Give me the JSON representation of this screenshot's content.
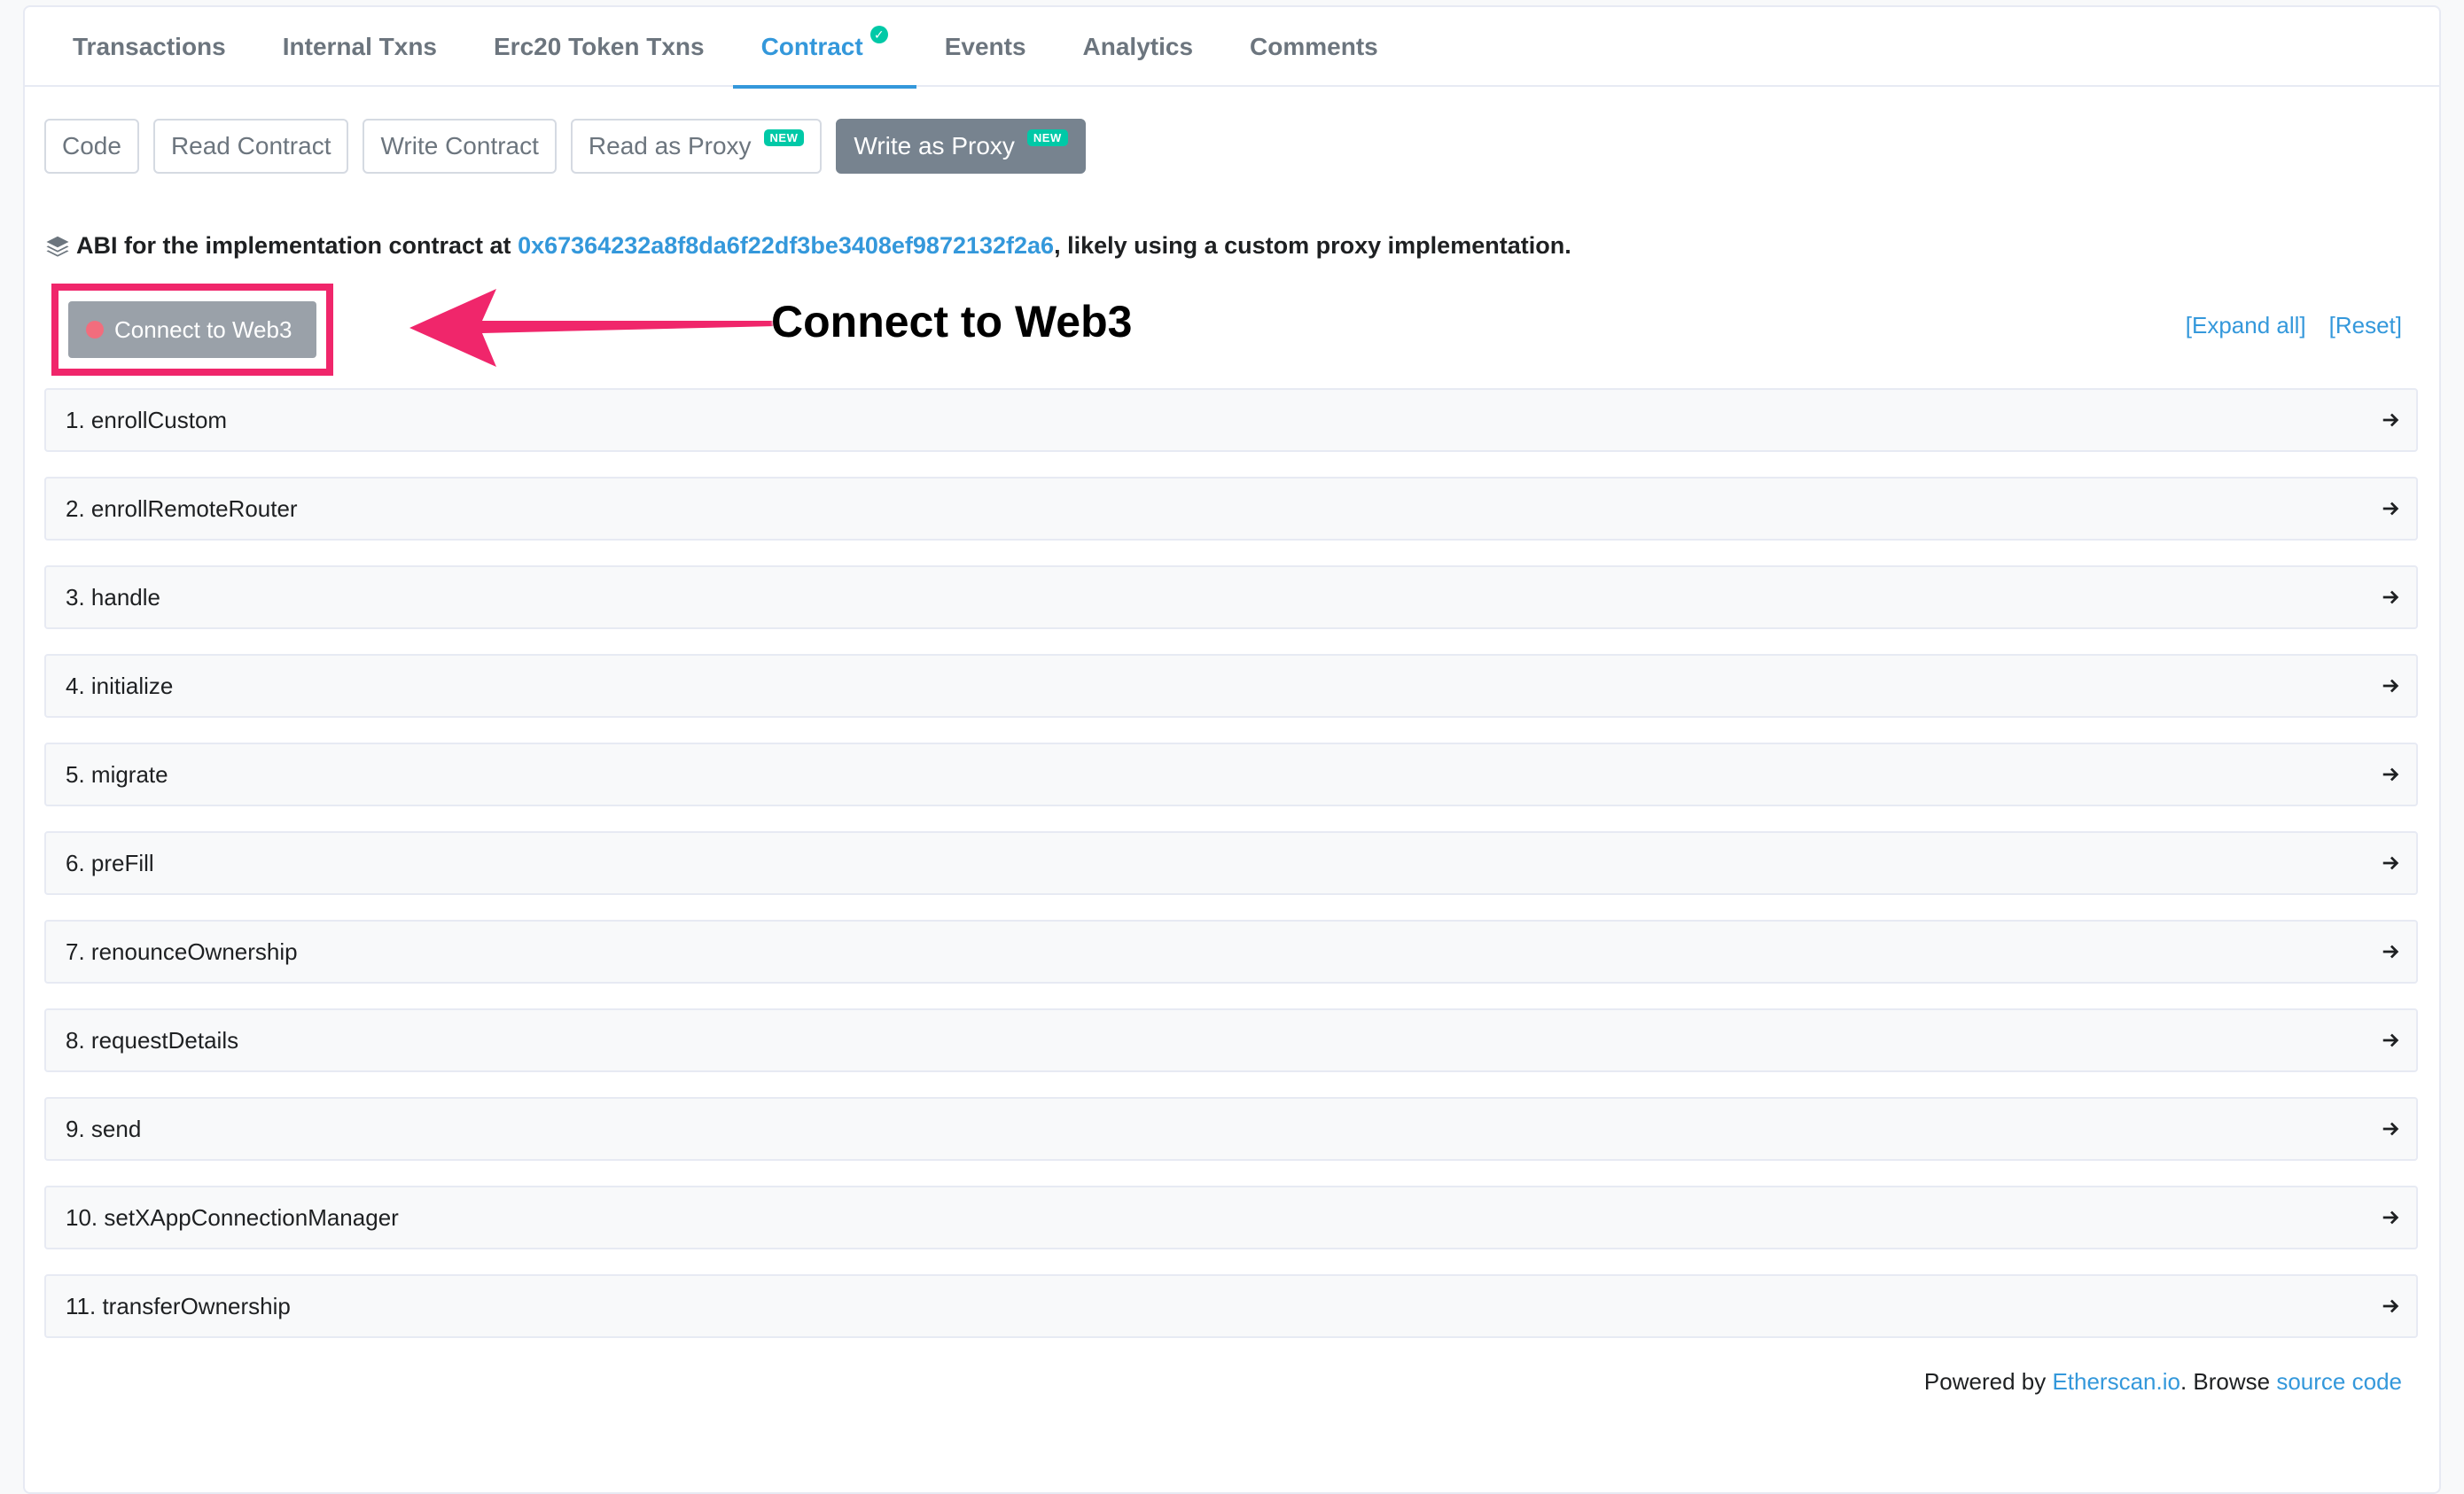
{
  "tabs": [
    {
      "label": "Transactions"
    },
    {
      "label": "Internal Txns"
    },
    {
      "label": "Erc20 Token Txns"
    },
    {
      "label": "Contract"
    },
    {
      "label": "Events"
    },
    {
      "label": "Analytics"
    },
    {
      "label": "Comments"
    }
  ],
  "subnav": {
    "code": "Code",
    "read_contract": "Read Contract",
    "write_contract": "Write Contract",
    "read_proxy": "Read as Proxy",
    "write_proxy": "Write as Proxy",
    "new_badge": "NEW"
  },
  "abi": {
    "prefix": "ABI for the implementation contract at ",
    "address": "0x67364232a8f8da6f22df3be3408ef9872132f2a6",
    "suffix": ", likely using a custom proxy implementation."
  },
  "connect": {
    "label": "Connect to Web3",
    "annotation": "Connect to Web3"
  },
  "tools": {
    "expand_all": "[Expand all]",
    "reset": "[Reset]"
  },
  "functions": [
    "1. enrollCustom",
    "2. enrollRemoteRouter",
    "3. handle",
    "4. initialize",
    "5. migrate",
    "6. preFill",
    "7. renounceOwnership",
    "8. requestDetails",
    "9. send",
    "10. setXAppConnectionManager",
    "11. transferOwnership"
  ],
  "footer": {
    "powered_by": "Powered by ",
    "etherscan": "Etherscan.io",
    "browse": ". Browse ",
    "source_code": "source code"
  },
  "colors": {
    "accent": "#3498db",
    "badge": "#00c9a7",
    "highlight": "#f0266b"
  }
}
